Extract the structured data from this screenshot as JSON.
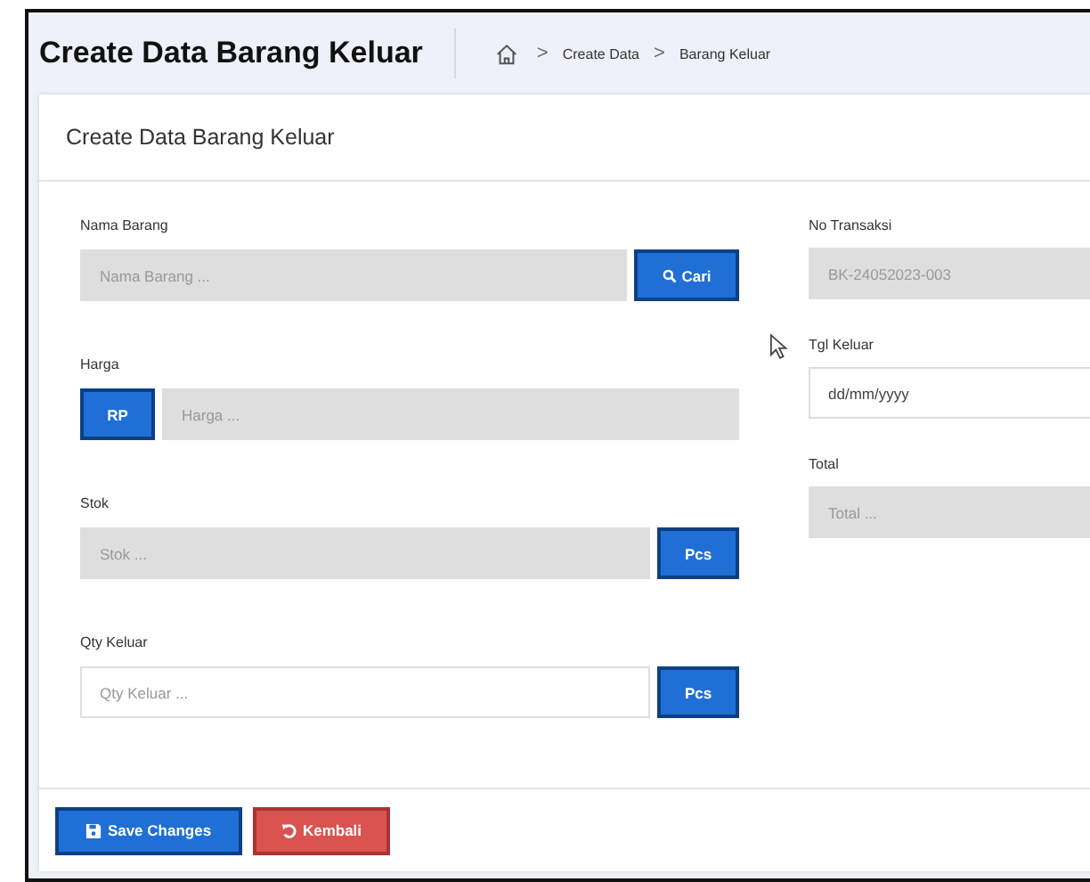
{
  "header": {
    "title": "Create Data Barang Keluar",
    "breadcrumb": [
      "Create Data",
      "Barang Keluar"
    ],
    "separator": ">"
  },
  "card": {
    "title": "Create Data Barang Keluar"
  },
  "left_fields": [
    {
      "label": "Nama Barang",
      "placeholder": "Nama Barang ...",
      "disabled": true,
      "addon": {
        "kind": "search",
        "label": "Cari"
      }
    },
    {
      "label": "Harga",
      "placeholder": "Harga ...",
      "disabled": true,
      "addon": {
        "kind": "prefix",
        "label": "RP"
      }
    },
    {
      "label": "Stok",
      "placeholder": "Stok ...",
      "disabled": true,
      "addon": {
        "kind": "unit",
        "label": "Pcs"
      }
    },
    {
      "label": "Qty Keluar",
      "placeholder": "Qty Keluar ...",
      "disabled": false,
      "addon": {
        "kind": "unit",
        "label": "Pcs"
      }
    }
  ],
  "right_fields": [
    {
      "label": "No Transaksi",
      "value": "BK-24052023-003",
      "disabled": true
    },
    {
      "label": "Tgl Keluar",
      "value": "dd/mm/yyyy",
      "disabled": false
    },
    {
      "label": "Total",
      "placeholder": "Total ...",
      "disabled": true
    }
  ],
  "buttons": [
    {
      "label": "Save Changes",
      "kind": "save"
    },
    {
      "label": "Kembali",
      "kind": "back"
    }
  ]
}
